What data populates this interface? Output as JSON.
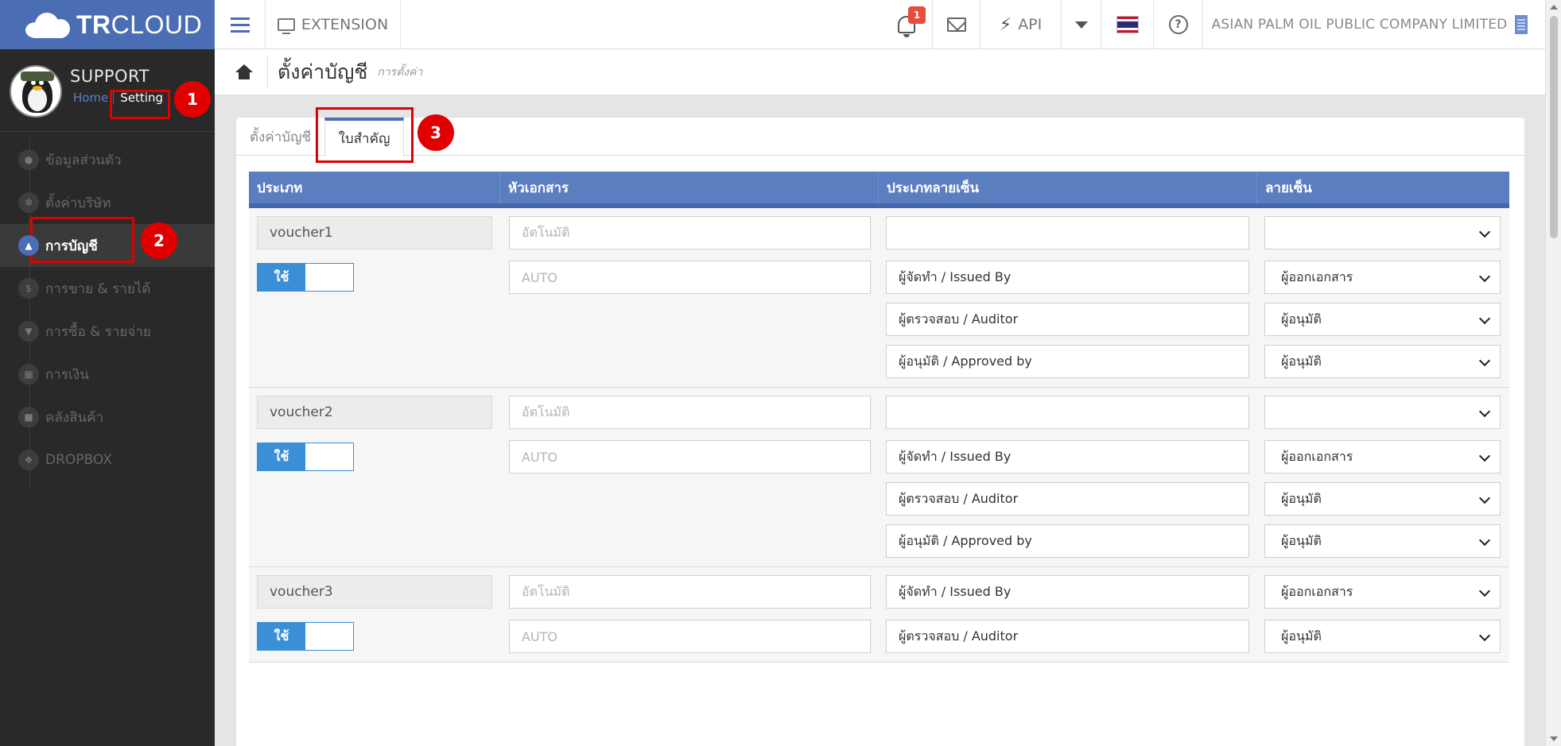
{
  "header": {
    "brand_bold": "TR",
    "brand_light": "CLOUD",
    "extension_label": "EXTENSION",
    "notification_count": "1",
    "api_label": "API",
    "company_name": "ASIAN PALM OIL PUBLIC COMPANY LIMITED"
  },
  "profile": {
    "name": "SUPPORT",
    "home_link": "Home",
    "setting_link": "Setting"
  },
  "sidebar": {
    "items": [
      {
        "label": "ข้อมูลส่วนตัว",
        "icon": "user-icon",
        "glyph": "●"
      },
      {
        "label": "ตั้งค่าบริษัท",
        "icon": "gear-icon",
        "glyph": "✻"
      },
      {
        "label": "การบัญชี",
        "icon": "accounting-icon",
        "glyph": "▲"
      },
      {
        "label": "การขาย & รายได้",
        "icon": "dollar-icon",
        "glyph": "$"
      },
      {
        "label": "การซื้อ & รายจ่าย",
        "icon": "cart-icon",
        "glyph": "▼"
      },
      {
        "label": "การเงิน",
        "icon": "calendar-icon",
        "glyph": "▦"
      },
      {
        "label": "คลังสินค้า",
        "icon": "truck-icon",
        "glyph": "■"
      },
      {
        "label": "DROPBOX",
        "icon": "dropbox-icon",
        "glyph": "❖"
      }
    ],
    "active_index": 2
  },
  "page": {
    "title": "ตั้งค่าบัญชี",
    "subtitle": "การตั้งค่า"
  },
  "tabs": [
    {
      "label": "ตั้งค่าบัญชี"
    },
    {
      "label": "ใบสำคัญ"
    }
  ],
  "table": {
    "headers": [
      "ประเภท",
      "หัวเอกสาร",
      "ประเภทลายเซ็น",
      "ลายเซ็น"
    ],
    "groups": [
      {
        "name": "voucher1",
        "header_placeholder": "อัตโนมัติ",
        "toggle_label": "ใช้",
        "number_placeholder": "AUTO",
        "top_signature_type": "",
        "top_signature": "",
        "signatures": [
          {
            "type": "ผู้จัดทำ / Issued By",
            "value": "ผู้ออกเอกสาร"
          },
          {
            "type": "ผู้ตรวจสอบ / Auditor",
            "value": "ผู้อนุมัติ"
          },
          {
            "type": "ผู้อนุมัติ / Approved by",
            "value": "ผู้อนุมัติ"
          }
        ]
      },
      {
        "name": "voucher2",
        "header_placeholder": "อัตโนมัติ",
        "toggle_label": "ใช้",
        "number_placeholder": "AUTO",
        "top_signature_type": "",
        "top_signature": "",
        "signatures": [
          {
            "type": "ผู้จัดทำ / Issued By",
            "value": "ผู้ออกเอกสาร"
          },
          {
            "type": "ผู้ตรวจสอบ / Auditor",
            "value": "ผู้อนุมัติ"
          },
          {
            "type": "ผู้อนุมัติ / Approved by",
            "value": "ผู้อนุมัติ"
          }
        ]
      },
      {
        "name": "voucher3",
        "header_placeholder": "อัตโนมัติ",
        "toggle_label": "ใช้",
        "number_placeholder": "AUTO",
        "top_signature_type": "ผู้จัดทำ / Issued By",
        "top_signature": "ผู้ออกเอกสาร",
        "signatures": [
          {
            "type": "ผู้ตรวจสอบ / Auditor",
            "value": "ผู้อนุมัติ"
          }
        ]
      }
    ]
  },
  "annotations": [
    "1",
    "2",
    "3"
  ],
  "colors": {
    "brand": "#4a6db4",
    "sidebar_bg": "#292929",
    "table_header": "#5b7ec0",
    "toggle": "#3a8fd6",
    "annotation": "#e00000",
    "badge": "#e74c3c"
  }
}
